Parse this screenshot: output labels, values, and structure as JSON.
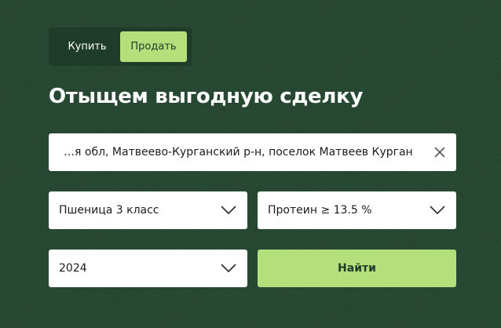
{
  "toggle": {
    "buy_label": "Купить",
    "sell_label": "Продать",
    "active": "sell"
  },
  "title": "Отыщем выгодную сделку",
  "address": {
    "value": "…я обл, Матвеево-Курганский р-н, поселок Матвеев Курган"
  },
  "crop_select": {
    "value": "Пшеница 3 класс"
  },
  "protein_select": {
    "value": "Протеин ≥ 13.5 %"
  },
  "year_select": {
    "value": "2024"
  },
  "search_button": {
    "label": "Найти"
  },
  "colors": {
    "background": "#264732",
    "accent": "#b3e07a",
    "toggle_bg": "#1f3b29"
  },
  "icons": {
    "clear": "close-icon",
    "dropdown": "chevron-down-icon"
  }
}
